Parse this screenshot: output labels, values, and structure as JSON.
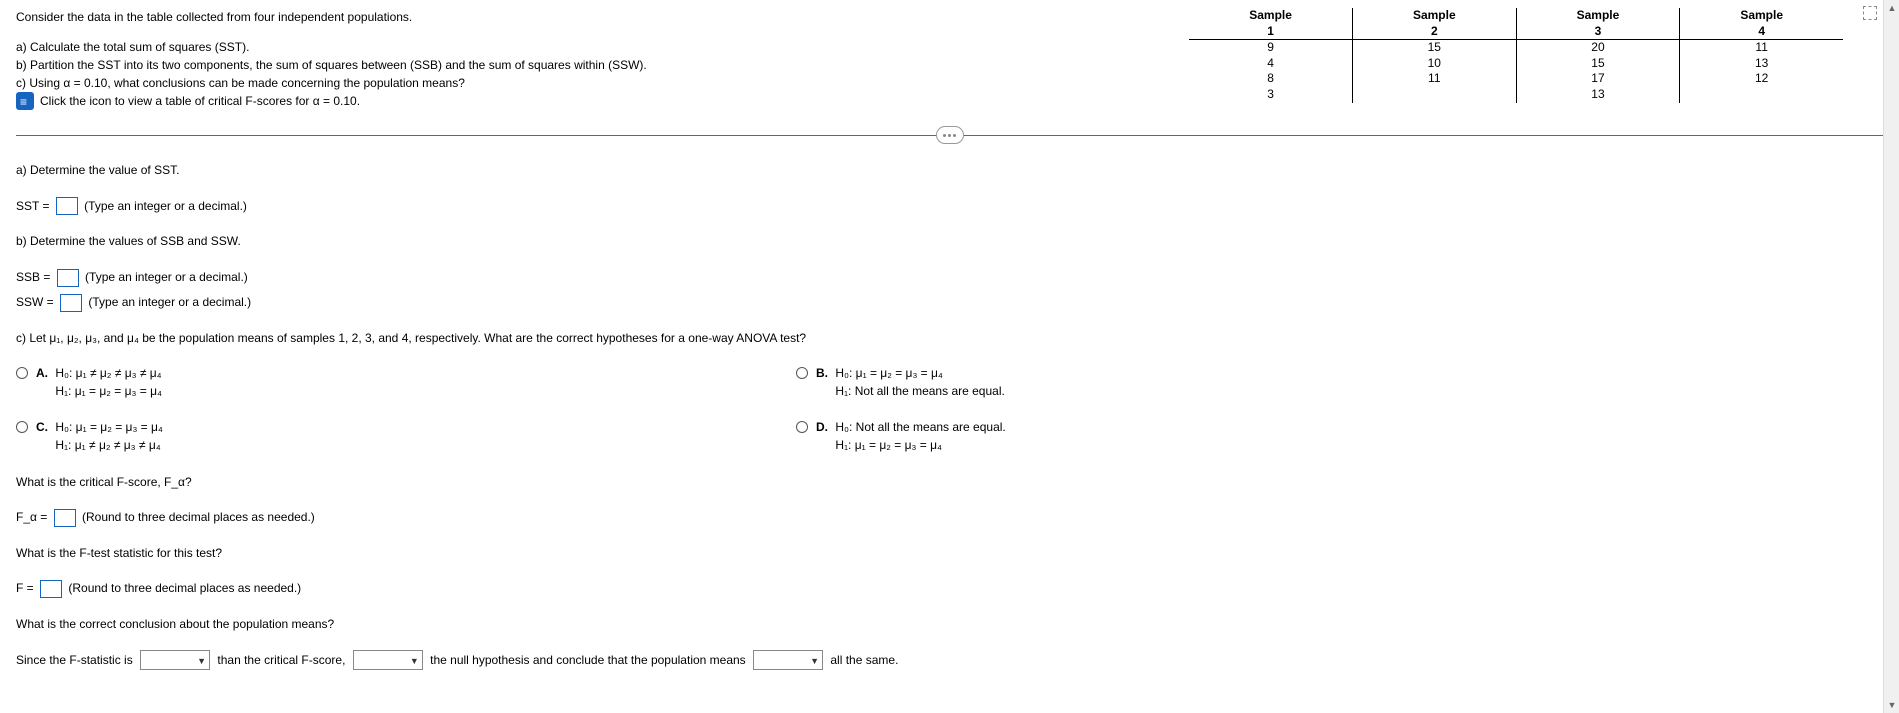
{
  "prompt_intro": "Consider the data in the table collected from four independent populations.",
  "parts": {
    "a": "a) Calculate the total sum of squares (SST).",
    "b": "b) Partition the SST into its two components, the sum of squares between (SSB) and the sum of squares within (SSW).",
    "c": "c) Using α = 0.10, what conclusions can be made concerning the population means?",
    "link": "Click the icon to view a table of critical F-scores for α = 0.10."
  },
  "table": {
    "headers_top": [
      "Sample",
      "Sample",
      "Sample",
      "Sample"
    ],
    "headers_num": [
      "1",
      "2",
      "3",
      "4"
    ],
    "rows": [
      [
        "9",
        "15",
        "20",
        "11"
      ],
      [
        "4",
        "10",
        "15",
        "13"
      ],
      [
        "8",
        "11",
        "17",
        "12"
      ],
      [
        "3",
        "",
        "13",
        ""
      ]
    ]
  },
  "qa": {
    "a_title": "a) Determine the value of SST.",
    "sst_label": "SST =",
    "int_dec_hint": "(Type an integer or a decimal.)",
    "b_title": "b) Determine the values of SSB and SSW.",
    "ssb_label": "SSB =",
    "ssw_label": "SSW =",
    "c_title": "c) Let μ₁, μ₂, μ₃, and μ₄ be the population means of samples 1, 2, 3, and 4, respectively. What are the correct hypotheses for a one-way ANOVA test?"
  },
  "options": {
    "A": {
      "letter": "A.",
      "line1": "H₀: μ₁ ≠ μ₂ ≠ μ₃ ≠ μ₄",
      "line2": "H₁: μ₁ = μ₂ = μ₃ = μ₄"
    },
    "B": {
      "letter": "B.",
      "line1": "H₀: μ₁ = μ₂ = μ₃ = μ₄",
      "line2": "H₁: Not all the means are equal."
    },
    "C": {
      "letter": "C.",
      "line1": "H₀: μ₁ = μ₂ = μ₃ = μ₄",
      "line2": "H₁: μ₁ ≠ μ₂ ≠ μ₃ ≠ μ₄"
    },
    "D": {
      "letter": "D.",
      "line1": "H₀: Not all the means are equal.",
      "line2": "H₁: μ₁ = μ₂ = μ₃ = μ₄"
    }
  },
  "follow": {
    "q_falpha": "What is the critical F-score, F_α?",
    "falpha_label": "F_α =",
    "round3_hint": "(Round to three decimal places as needed.)",
    "q_fstat": "What is the F-test statistic for this test?",
    "f_label": "F =",
    "q_conclusion": "What is the correct conclusion about the population means?",
    "conclusion_1": "Since the F-statistic is",
    "conclusion_2": "than the critical F-score,",
    "conclusion_3": "the null hypothesis and conclude that the population means",
    "conclusion_4": "all the same."
  }
}
